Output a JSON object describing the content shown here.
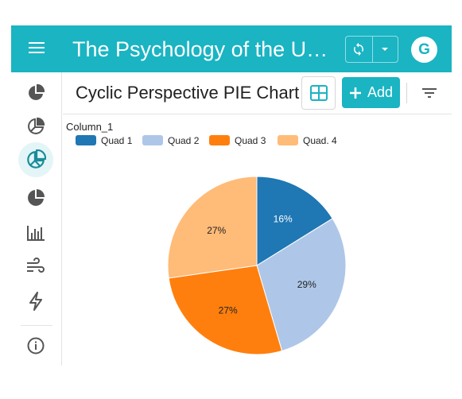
{
  "header": {
    "title": "The Psychology of the Unive...",
    "avatar_letter": "G",
    "icons": [
      "menu-icon",
      "sync-icon",
      "caret-down-icon"
    ]
  },
  "sidebar": {
    "items": [
      {
        "icon": "pie-chart-icon",
        "active": false
      },
      {
        "icon": "pie-chart-exploded-icon",
        "active": false
      },
      {
        "icon": "pie-chart-outline-icon",
        "active": true
      },
      {
        "icon": "pie-chart-quarter-icon",
        "active": false
      },
      {
        "icon": "bar-chart-icon",
        "active": false
      },
      {
        "icon": "wind-icon",
        "active": false
      },
      {
        "icon": "lightning-icon",
        "active": false
      },
      {
        "icon": "info-icon",
        "active": false
      }
    ]
  },
  "toolbar": {
    "chart_title": "Cyclic Perspective PIE Chart",
    "add_label": "Add",
    "icons": [
      "grid-view-icon",
      "plus-icon",
      "filter-icon"
    ]
  },
  "colors": {
    "accent": "#1ab4c3",
    "quad1": "#1f77b4",
    "quad2": "#aec7e8",
    "quad3": "#ff7f0e",
    "quad4": "#ffbb78"
  },
  "chart_data": {
    "type": "pie",
    "title": "Column_1",
    "legend_position": "top-left",
    "categories": [
      "Quad 1",
      "Quad 2",
      "Quad 3",
      "Quad. 4"
    ],
    "values": [
      16,
      29,
      27,
      27
    ],
    "labels": [
      "16%",
      "29%",
      "27%",
      "27%"
    ],
    "colors": [
      "#1f77b4",
      "#aec7e8",
      "#ff7f0e",
      "#ffbb78"
    ],
    "start_angle_deg": 0,
    "direction": "clockwise"
  }
}
